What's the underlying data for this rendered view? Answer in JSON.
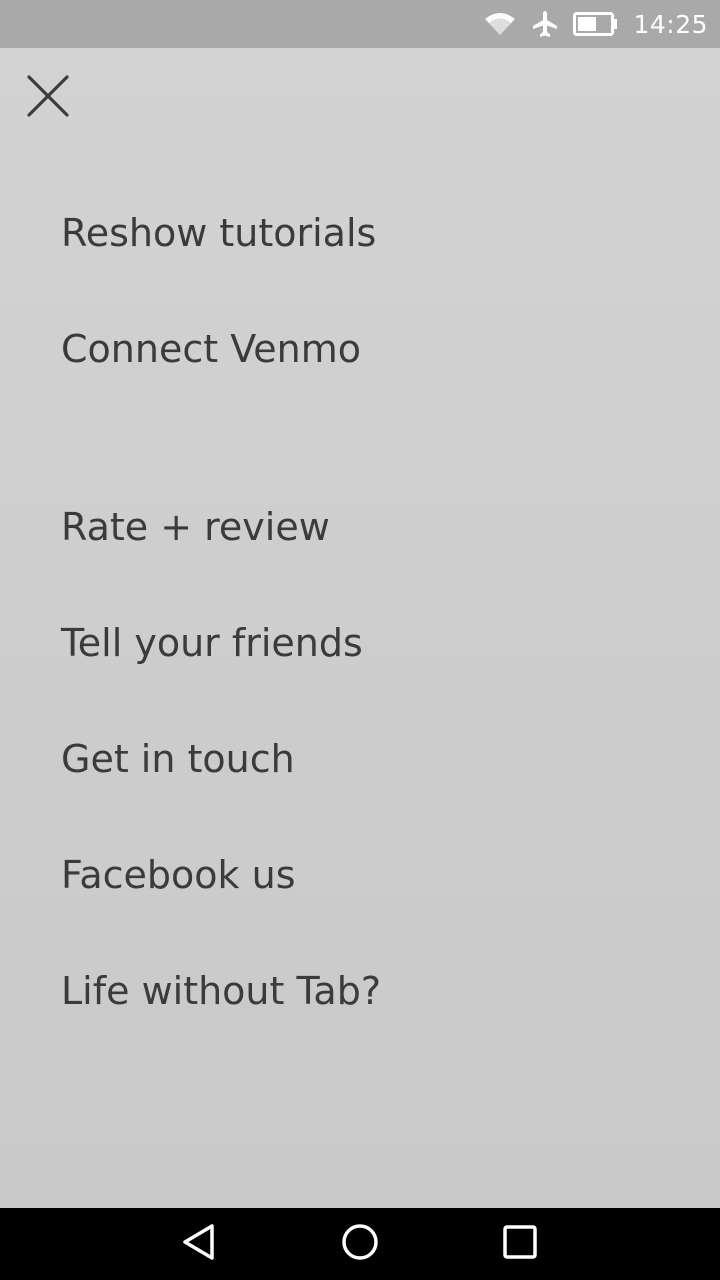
{
  "status_bar": {
    "time": "14:25",
    "icons": [
      "wifi-icon",
      "airplane-mode-icon",
      "battery-icon"
    ]
  },
  "close": {
    "icon": "close-icon"
  },
  "menu": {
    "items": [
      {
        "label": "Reshow tutorials"
      },
      {
        "label": "Connect Venmo"
      },
      {
        "label": "Rate + review"
      },
      {
        "label": "Tell your friends"
      },
      {
        "label": "Get in touch"
      },
      {
        "label": "Facebook us"
      },
      {
        "label": "Life without Tab?"
      }
    ]
  },
  "nav_bar": {
    "buttons": [
      "back-icon",
      "home-icon",
      "recents-icon"
    ]
  },
  "colors": {
    "background": "#cfcfcf",
    "status_bar": "#a9a9a9",
    "text": "#3b3b3b",
    "nav_bar": "#000000"
  }
}
